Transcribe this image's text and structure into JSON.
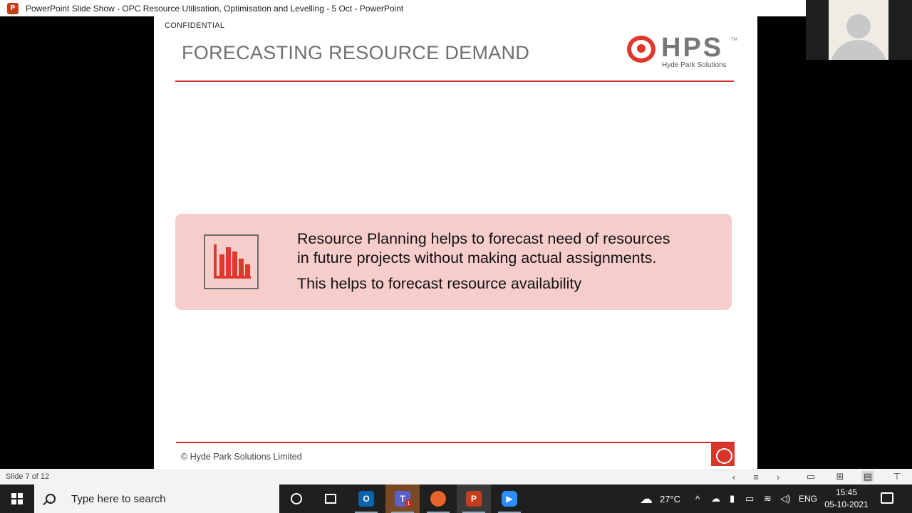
{
  "window": {
    "app_icon_letter": "P",
    "title": "PowerPoint Slide Show  -  OPC Resource Utilisation, Optimisation and Levelling - 5 Oct - PowerPoint"
  },
  "slide": {
    "confidential": "CONFIDENTIAL",
    "title": "FORECASTING RESOURCE DEMAND",
    "logo": {
      "mark": "HPS",
      "tm": "TM",
      "subtitle": "Hyde Park Solutions"
    },
    "info_box": {
      "icon": "bar-chart-icon",
      "line1": "Resource Planning helps to forecast need of resources",
      "line2": "in future projects without making actual assignments.",
      "line3": "This helps to forecast resource availability"
    },
    "footer": "© Hyde Park Solutions Limited"
  },
  "statusbar": {
    "slide_counter": "Slide 7 of 12"
  },
  "taskbar": {
    "search_placeholder": "Type here to search",
    "teams_badge": "1",
    "weather": "27°C",
    "language": "ENG",
    "time": "15:45",
    "date": "05-10-2021"
  },
  "colors": {
    "accent_red": "#d42b2b",
    "box_pink": "#f7cdcc",
    "title_gray": "#6f6f6f"
  }
}
